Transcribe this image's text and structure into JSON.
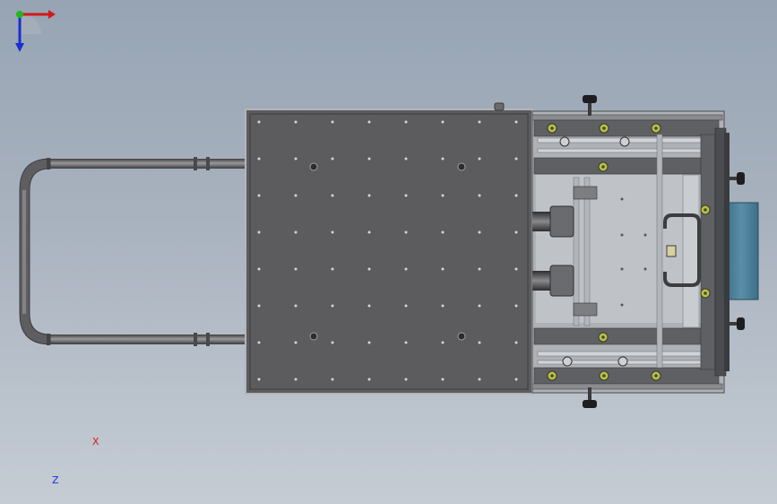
{
  "triad": {
    "x_label": "X",
    "z_label": "Z",
    "colors": {
      "x": "#d21a1a",
      "y": "#1fb81f",
      "z": "#1a2fd2"
    }
  },
  "colors": {
    "plate": "#5c5c5e",
    "frame": "#6e6e70",
    "handle": "#6a6a6c",
    "screw": "#b8c24a",
    "blue_panel": "#4e7f98"
  }
}
